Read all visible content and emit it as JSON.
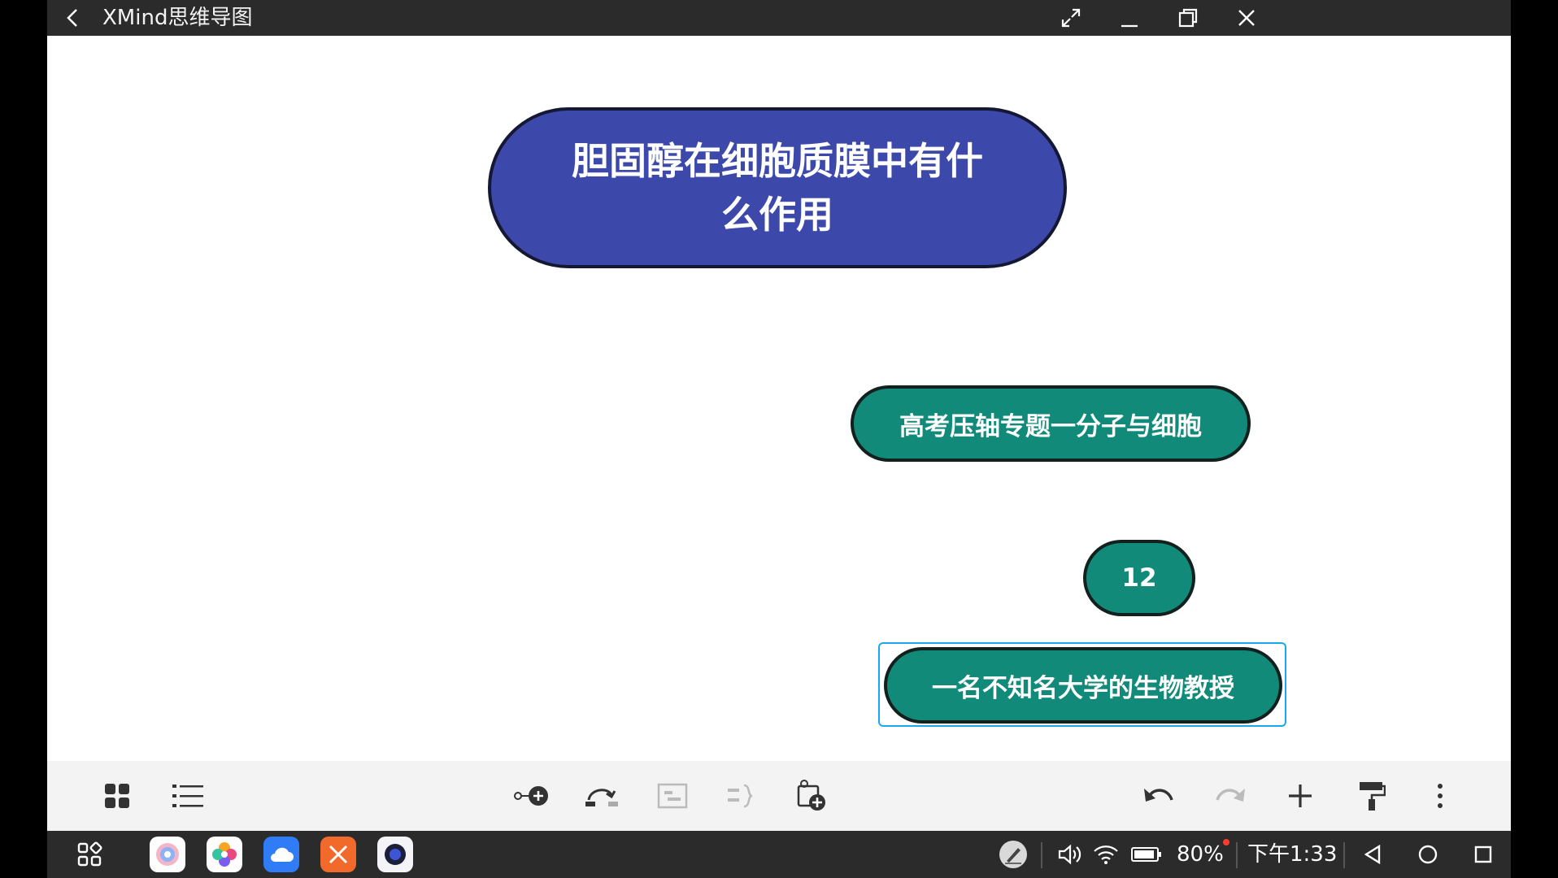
{
  "window": {
    "title": "XMind思维导图"
  },
  "mindmap": {
    "central_topic": "胆固醇在细胞质膜中有什么作用",
    "subtopics": [
      "高考压轴专题一分子与细胞",
      "12",
      "一名不知名大学的生物教授"
    ],
    "colors": {
      "central": "#3c49aa",
      "subtopic": "#118a79",
      "selection": "#1aa7f0"
    }
  },
  "statusbar": {
    "battery": "80%",
    "time": "下午1:33"
  },
  "icons": {
    "titlebar": [
      "back-icon",
      "fullscreen-icon",
      "minimize-icon",
      "restore-icon",
      "close-icon"
    ],
    "toolbar_left": [
      "grid-view-icon",
      "outline-list-icon"
    ],
    "toolbar_center": [
      "add-subtopic-icon",
      "add-relationship-icon",
      "add-summary-icon",
      "add-boundary-icon",
      "insert-topic-icon"
    ],
    "toolbar_right": [
      "undo-icon",
      "redo-icon",
      "add-icon",
      "format-painter-icon",
      "more-icon"
    ],
    "taskbar": [
      "app-drawer-icon",
      "browser-app-icon",
      "gallery-app-icon",
      "cloud-app-icon",
      "xmind-app-icon",
      "camera-app-icon",
      "stylus-icon",
      "volume-icon",
      "wifi-icon",
      "battery-icon",
      "nav-back-icon",
      "nav-home-icon",
      "nav-recents-icon"
    ]
  }
}
